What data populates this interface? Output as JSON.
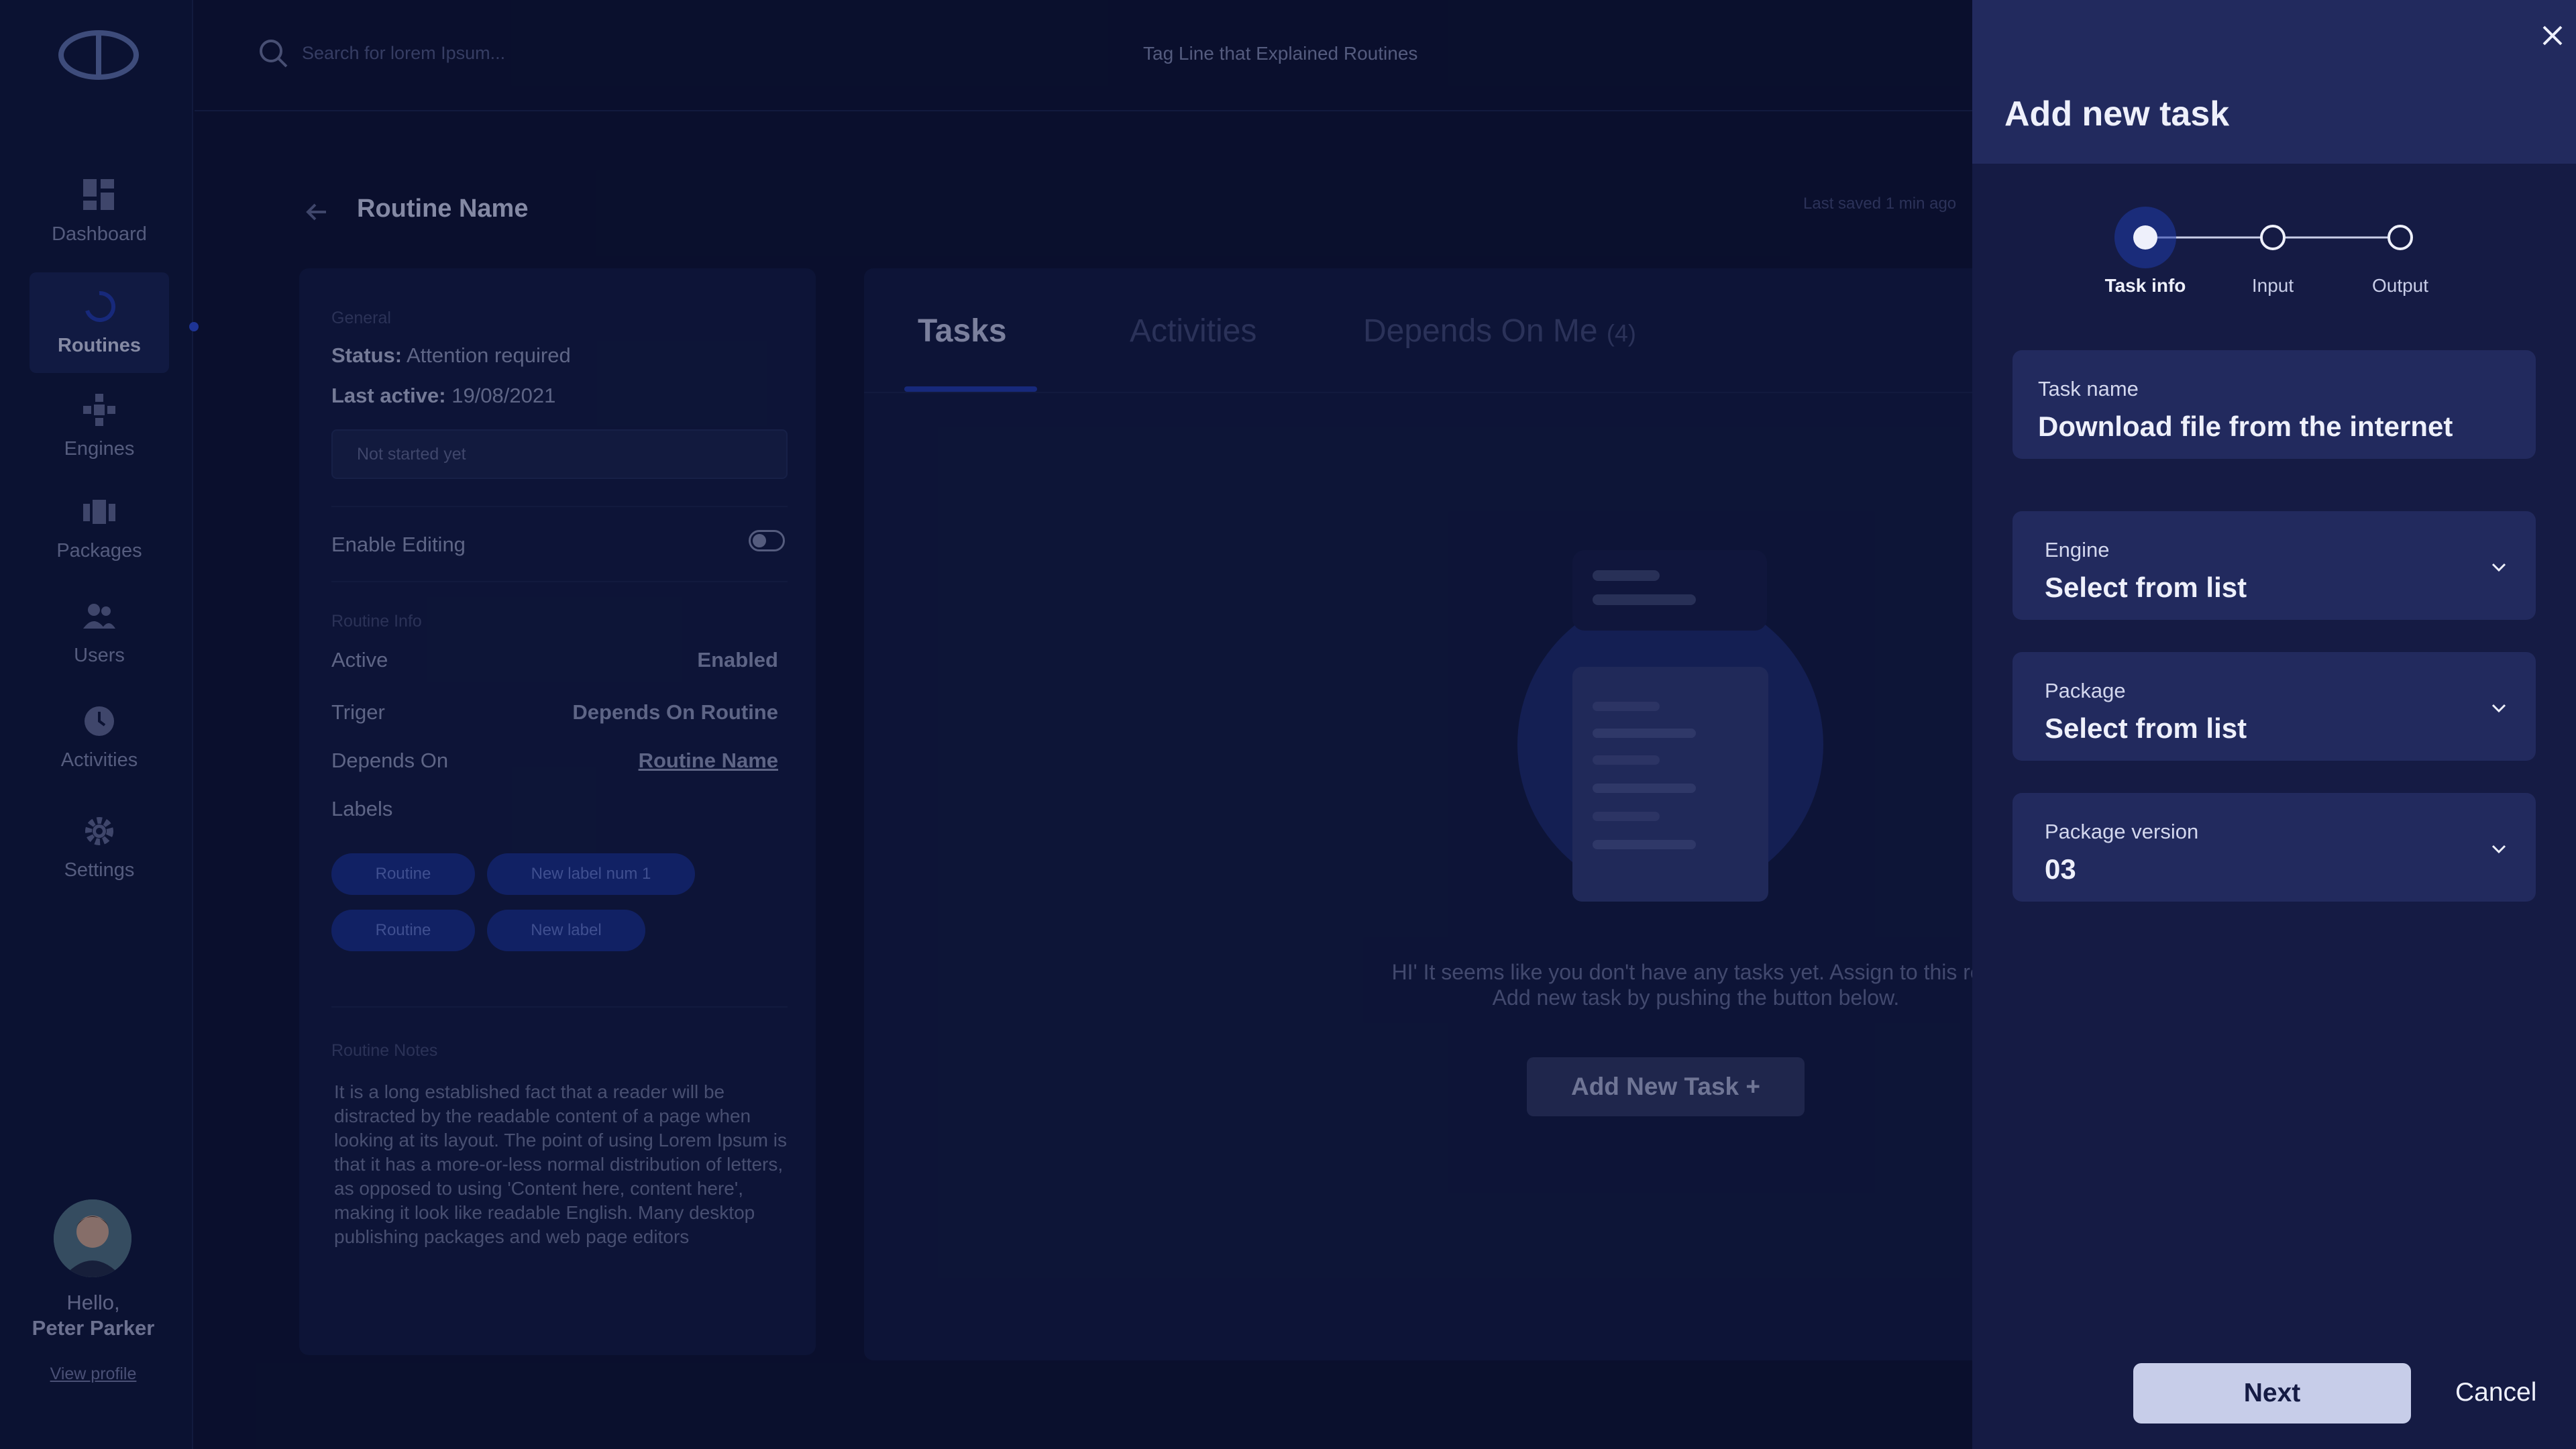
{
  "topbar": {
    "search_placeholder": "Search for lorem Ipsum...",
    "tagline": "Tag Line that Explained Routines"
  },
  "sidebar": {
    "items": [
      {
        "label": "Dashboard",
        "icon": "dashboard-icon",
        "active": false
      },
      {
        "label": "Routines",
        "icon": "routines-icon",
        "active": true
      },
      {
        "label": "Engines",
        "icon": "engines-icon",
        "active": false
      },
      {
        "label": "Packages",
        "icon": "packages-icon",
        "active": false
      },
      {
        "label": "Users",
        "icon": "users-icon",
        "active": false
      },
      {
        "label": "Activities",
        "icon": "activities-icon",
        "active": false
      },
      {
        "label": "Settings",
        "icon": "settings-icon",
        "active": false
      }
    ],
    "greeting": "Hello,",
    "user_name": "Peter Parker",
    "view_profile": "View profile"
  },
  "routine": {
    "title": "Routine Name",
    "last_saved": "Last saved 1 min ago",
    "general_label": "General",
    "status_key": "Status:",
    "status_value": "Attention required",
    "last_active_key": "Last active:",
    "last_active_value": "19/08/2021",
    "progress_text": "Not started yet",
    "enable_editing": "Enable Editing",
    "routine_info_label": "Routine Info",
    "info": [
      {
        "key": "Active",
        "value": "Enabled"
      },
      {
        "key": "Triger",
        "value": "Depends On Routine"
      },
      {
        "key": "Depends On",
        "value": "Routine Name"
      },
      {
        "key": "Labels",
        "value": ""
      }
    ],
    "labels": [
      "Routine",
      "New label num 1",
      "Routine",
      "New label"
    ],
    "notes_label": "Routine Notes",
    "notes": "It is a long established fact that a reader will be distracted by the readable content of a page when looking at its layout. The point of using Lorem Ipsum is that it has a more-or-less normal distribution of letters, as opposed to using 'Content here, content here', making it look like readable English. Many desktop publishing packages and web page editors"
  },
  "main": {
    "tabs": [
      {
        "label": "Tasks",
        "active": true
      },
      {
        "label": "Activities",
        "active": false
      },
      {
        "label": "Depends On Me",
        "count": "(4)",
        "active": false
      }
    ],
    "empty_line1": "HI' It seems like you don't have any tasks yet. Assign to this rout",
    "empty_line2": "Add new task by pushing the button below.",
    "add_button": "Add New Task +"
  },
  "panel": {
    "title": "Add new task",
    "steps": [
      {
        "label": "Task info",
        "active": true
      },
      {
        "label": "Input",
        "active": false
      },
      {
        "label": "Output",
        "active": false
      }
    ],
    "fields": {
      "task_name_label": "Task name",
      "task_name_value": "Download file from the internet",
      "engine_label": "Engine",
      "engine_value": "Select from list",
      "package_label": "Package",
      "package_value": "Select from list",
      "version_label": "Package version",
      "version_value": "03"
    },
    "next": "Next",
    "cancel": "Cancel"
  },
  "colors": {
    "background": "#0b1230",
    "panel": "#151b44",
    "panel_header": "#222a5e",
    "accent": "#1f3aa8",
    "next_button": "#c7cde9"
  }
}
